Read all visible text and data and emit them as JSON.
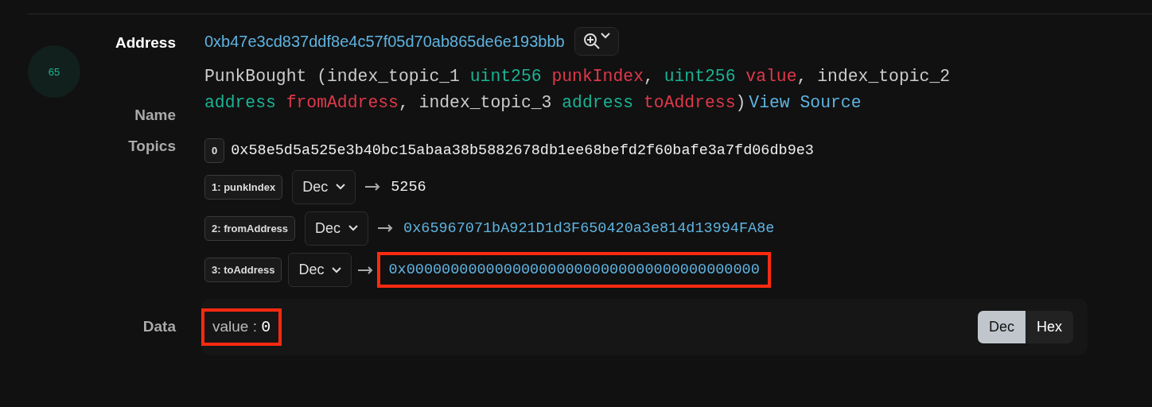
{
  "log_index": "65",
  "address": {
    "label": "Address",
    "value": "0xb47e3cd837ddf8e4c57f05d70ab865de6e193bbb"
  },
  "name": {
    "label": "Name",
    "tokens": [
      {
        "kind": "plain",
        "text": "PunkBought (index_topic_1 "
      },
      {
        "kind": "type",
        "text": "uint256"
      },
      {
        "kind": "param",
        "text": "punkIndex"
      },
      {
        "kind": "plain",
        "text": ", "
      },
      {
        "kind": "type",
        "text": "uint256"
      },
      {
        "kind": "param",
        "text": "value"
      },
      {
        "kind": "plain",
        "text": ", index_topic_2 "
      },
      {
        "kind": "type",
        "text": "address"
      },
      {
        "kind": "param",
        "text": "fromAddress"
      },
      {
        "kind": "plain",
        "text": ", index_topic_3 "
      },
      {
        "kind": "type",
        "text": "address"
      },
      {
        "kind": "param",
        "text": "toAddress"
      },
      {
        "kind": "plain",
        "text": ")"
      },
      {
        "kind": "link",
        "text": "View Source"
      }
    ]
  },
  "topics": {
    "label": "Topics",
    "items": [
      {
        "badge": "0",
        "value": "0x58e5d5a525e3b40bc15abaa38b5882678db1ee68befd2f60bafe3a7fd06db9e3",
        "link": false,
        "highlight": false
      },
      {
        "badge": "1: punkIndex",
        "format": "Dec",
        "value": "5256",
        "link": false,
        "highlight": false
      },
      {
        "badge": "2: fromAddress",
        "format": "Dec",
        "value": "0x65967071bA921D1d3F650420a3e814d13994FA8e",
        "link": true,
        "highlight": false
      },
      {
        "badge": "3: toAddress",
        "format": "Dec",
        "value": "0x0000000000000000000000000000000000000000",
        "link": true,
        "highlight": true
      }
    ]
  },
  "data": {
    "label": "Data",
    "key": "value",
    "separator": ":",
    "value": "0",
    "highlight": true,
    "modes": [
      {
        "label": "Dec",
        "selected": true
      },
      {
        "label": "Hex",
        "selected": false
      }
    ]
  }
}
